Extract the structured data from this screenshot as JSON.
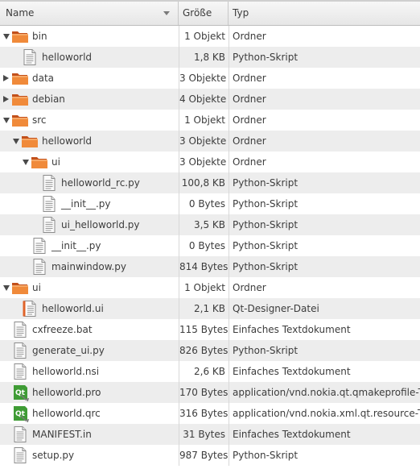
{
  "header": {
    "name": "Name",
    "size": "Größe",
    "type": "Typ"
  },
  "rows": [
    {
      "name": "bin",
      "size": "1 Objekt",
      "type": "Ordner",
      "depth": 0,
      "icon": "folder-icon",
      "expander": "open"
    },
    {
      "name": "helloworld",
      "size": "1,8 KB",
      "type": "Python-Skript",
      "depth": 1,
      "icon": "text-file-icon",
      "expander": "none"
    },
    {
      "name": "data",
      "size": "3 Objekte",
      "type": "Ordner",
      "depth": 0,
      "icon": "folder-icon",
      "expander": "closed"
    },
    {
      "name": "debian",
      "size": "4 Objekte",
      "type": "Ordner",
      "depth": 0,
      "icon": "folder-icon",
      "expander": "closed"
    },
    {
      "name": "src",
      "size": "1 Objekt",
      "type": "Ordner",
      "depth": 0,
      "icon": "folder-icon",
      "expander": "open"
    },
    {
      "name": "helloworld",
      "size": "3 Objekte",
      "type": "Ordner",
      "depth": 1,
      "icon": "folder-icon",
      "expander": "open"
    },
    {
      "name": "ui",
      "size": "3 Objekte",
      "type": "Ordner",
      "depth": 2,
      "icon": "folder-icon",
      "expander": "open"
    },
    {
      "name": "helloworld_rc.py",
      "size": "100,8 KB",
      "type": "Python-Skript",
      "depth": 3,
      "icon": "text-file-icon",
      "expander": "none"
    },
    {
      "name": "__init__.py",
      "size": "0 Bytes",
      "type": "Python-Skript",
      "depth": 3,
      "icon": "text-file-icon",
      "expander": "none"
    },
    {
      "name": "ui_helloworld.py",
      "size": "3,5 KB",
      "type": "Python-Skript",
      "depth": 3,
      "icon": "text-file-icon",
      "expander": "none"
    },
    {
      "name": "__init__.py",
      "size": "0 Bytes",
      "type": "Python-Skript",
      "depth": 2,
      "icon": "text-file-icon",
      "expander": "none"
    },
    {
      "name": "mainwindow.py",
      "size": "814 Bytes",
      "type": "Python-Skript",
      "depth": 2,
      "icon": "text-file-icon",
      "expander": "none"
    },
    {
      "name": "ui",
      "size": "1 Objekt",
      "type": "Ordner",
      "depth": 0,
      "icon": "folder-icon",
      "expander": "open"
    },
    {
      "name": "helloworld.ui",
      "size": "2,1 KB",
      "type": "Qt-Designer-Datei",
      "depth": 1,
      "icon": "designer-file-icon",
      "expander": "none"
    },
    {
      "name": "cxfreeze.bat",
      "size": "115 Bytes",
      "type": "Einfaches Textdokument",
      "depth": 0,
      "icon": "text-file-icon",
      "expander": "none"
    },
    {
      "name": "generate_ui.py",
      "size": "826 Bytes",
      "type": "Python-Skript",
      "depth": 0,
      "icon": "text-file-icon",
      "expander": "none"
    },
    {
      "name": "helloworld.nsi",
      "size": "2,6 KB",
      "type": "Einfaches Textdokument",
      "depth": 0,
      "icon": "text-file-icon",
      "expander": "none"
    },
    {
      "name": "helloworld.pro",
      "size": "170 Bytes",
      "type": "application/vnd.nokia.qt.qmakeprofile-Typ",
      "depth": 0,
      "icon": "qt-file-icon",
      "expander": "none"
    },
    {
      "name": "helloworld.qrc",
      "size": "316 Bytes",
      "type": "application/vnd.nokia.xml.qt.resource-Typ",
      "depth": 0,
      "icon": "qt-file-icon",
      "expander": "none"
    },
    {
      "name": "MANIFEST.in",
      "size": "31 Bytes",
      "type": "Einfaches Textdokument",
      "depth": 0,
      "icon": "text-file-icon",
      "expander": "none"
    },
    {
      "name": "setup.py",
      "size": "987 Bytes",
      "type": "Python-Skript",
      "depth": 0,
      "icon": "text-file-icon",
      "expander": "none"
    }
  ]
}
